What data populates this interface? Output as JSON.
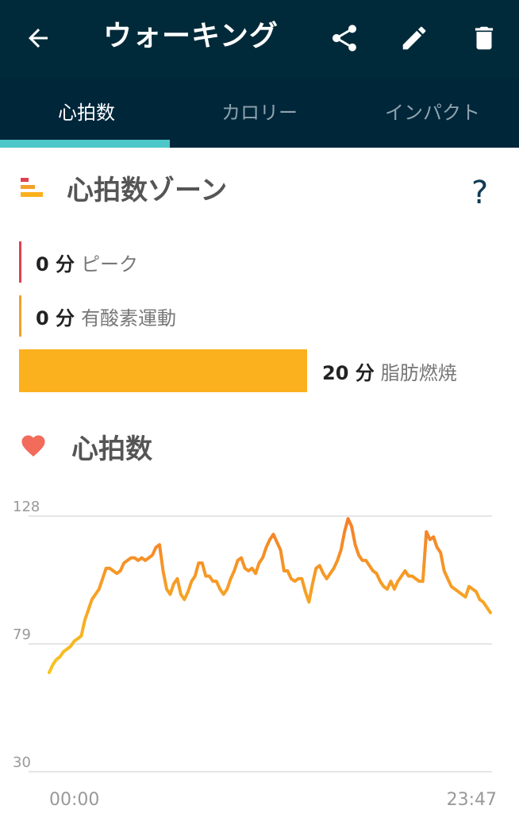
{
  "app_bar": {
    "title": "ウォーキング",
    "back_icon": "arrow-left-icon",
    "actions": [
      "share-icon",
      "edit-pencil-icon",
      "trash-icon"
    ]
  },
  "tabs": [
    {
      "label": "心拍数",
      "active": true
    },
    {
      "label": "カロリー",
      "active": false
    },
    {
      "label": "インパクト",
      "active": false
    }
  ],
  "zones": {
    "title": "心拍数ゾーン",
    "help": "?",
    "items": [
      {
        "minutes": "0 分",
        "name": "ピーク",
        "color": "#e0414f"
      },
      {
        "minutes": "0 分",
        "name": "有酸素運動",
        "color": "#f3a02a"
      },
      {
        "minutes": "20 分",
        "name": "脂肪燃焼",
        "color": "#fbb11d"
      }
    ]
  },
  "heart_rate": {
    "title": "心拍数",
    "icon": "heart-icon"
  },
  "colors": {
    "app_bar": "#002a3a",
    "tab_indicator": "#4ec7c8",
    "line_start": "#f8c51e",
    "line_end": "#f47f2b"
  },
  "chart_data": {
    "type": "line",
    "title": "",
    "xlabel": "",
    "ylabel": "",
    "ylim": [
      30,
      128
    ],
    "y_ticks": [
      128,
      79,
      30
    ],
    "x_tick_labels": [
      "00:00",
      "23:47"
    ],
    "grid": true,
    "series": [
      {
        "values": [
          68,
          71,
          73,
          74,
          76,
          77,
          78,
          80,
          81,
          82,
          88,
          92,
          96,
          98,
          100,
          104,
          108,
          108,
          107,
          106,
          107,
          110,
          111,
          112,
          112,
          111,
          112,
          111,
          112,
          113,
          116,
          117,
          107,
          100,
          98,
          102,
          104,
          98,
          96,
          99,
          103,
          105,
          110,
          110,
          105,
          105,
          103,
          103,
          100,
          98,
          100,
          104,
          107,
          111,
          112,
          108,
          107,
          108,
          106,
          110,
          112,
          116,
          119,
          121,
          118,
          115,
          107,
          107,
          104,
          103,
          104,
          104,
          99,
          95,
          102,
          108,
          109,
          106,
          104,
          106,
          108,
          111,
          115,
          122,
          127,
          124,
          117,
          113,
          111,
          111,
          109,
          107,
          106,
          103,
          101,
          100,
          103,
          100,
          103,
          105,
          107,
          105,
          105,
          104,
          103,
          103,
          122,
          119,
          120,
          116,
          114,
          107,
          104,
          101,
          100,
          99,
          98,
          97,
          101,
          100,
          99,
          96,
          95,
          93,
          91
        ]
      }
    ]
  }
}
